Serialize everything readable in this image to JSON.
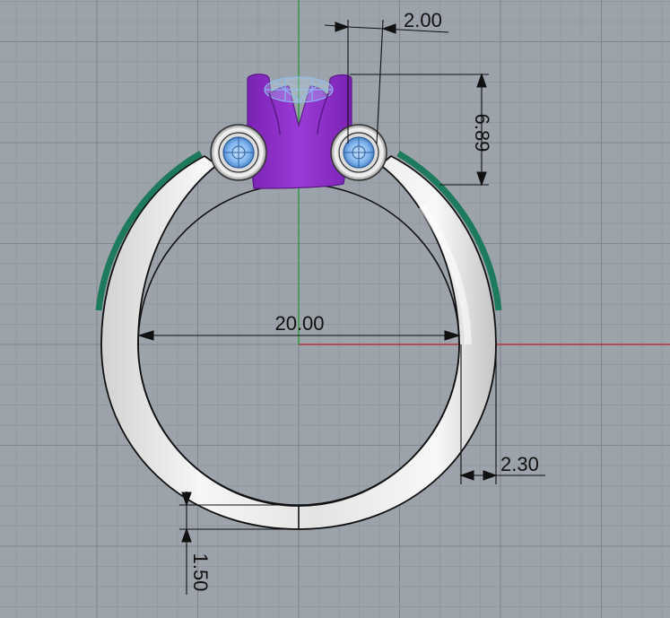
{
  "dimensions": {
    "prong_width": "2.00",
    "head_height": "6.89",
    "inner_diameter": "20.00",
    "shank_width": "2.30",
    "bottom_thickness": "1.50"
  },
  "colors": {
    "background": "#9da3aa",
    "grid_minor": "#8f959c",
    "grid_major": "#80868d",
    "axis_x": "#b32020",
    "axis_y": "#1d9a2d",
    "metal_light": "#f2f2f2",
    "metal_dark": "#b9b9b9",
    "head_purple": "#8a2bc4",
    "stone_blue": "#7fb4ee",
    "green_band": "#1d7a5c",
    "dimension_line": "#111111"
  },
  "icons": {
    "left_accent_stone": "side-stone-icon",
    "right_accent_stone": "side-stone-icon",
    "center_stone": "gem-icon"
  }
}
